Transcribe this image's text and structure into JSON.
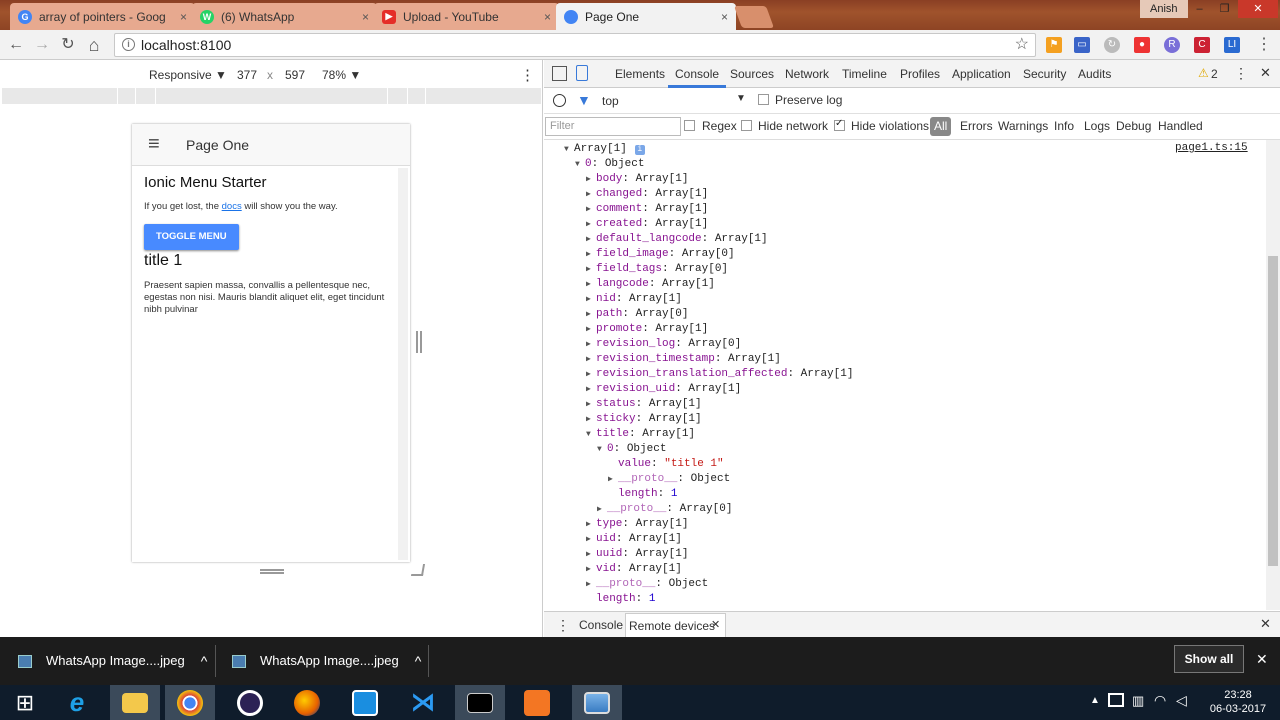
{
  "browser": {
    "tabs": [
      {
        "title": "array of pointers - Goog",
        "icon": "google-icon",
        "color": "#4285f4"
      },
      {
        "title": "(6) WhatsApp",
        "icon": "whatsapp-icon",
        "color": "#25d366"
      },
      {
        "title": "Upload - YouTube",
        "icon": "youtube-icon",
        "color": "#e52d27"
      },
      {
        "title": "Page One",
        "icon": "chrome-tab-icon",
        "color": "#4285f4"
      }
    ],
    "close_glyph": "×",
    "user": "Anish",
    "window_min": "–",
    "window_max": "❐",
    "window_close": "✕",
    "url": "localhost:8100",
    "back": "←",
    "forward": "→",
    "reload": "↻",
    "home": "⌂",
    "star": "☆",
    "menu": "⋮"
  },
  "device_toolbar": {
    "mode": "Responsive ▼",
    "width": "377",
    "x": "x",
    "height": "597",
    "zoom": "78% ▼",
    "more": "⋮"
  },
  "app": {
    "menu_icon": "≡",
    "header_title": "Page One",
    "heading": "Ionic Menu Starter",
    "intro_before": "If you get lost, the ",
    "intro_link": "docs",
    "intro_after": " will show you the way.",
    "toggle_button": "TOGGLE MENU",
    "card_title": "title 1",
    "card_text": "Praesent sapien massa, convallis a pellentesque nec, egestas non nisi. Mauris blandit aliquet elit, eget tincidunt nibh pulvinar"
  },
  "devtools": {
    "tabs": [
      "Elements",
      "Console",
      "Sources",
      "Network",
      "Timeline",
      "Profiles",
      "Application",
      "Security",
      "Audits"
    ],
    "active_tab": "Console",
    "warning_count": "2",
    "context": "top",
    "preserve_log": "Preserve log",
    "filter_placeholder": "Filter",
    "regex": "Regex",
    "hide_network": "Hide network",
    "hide_violations": "Hide violations",
    "levels": [
      "All",
      "Errors",
      "Warnings",
      "Info",
      "Logs",
      "Debug",
      "Handled"
    ],
    "source_link": "page1.ts:15",
    "drawer_tabs": [
      "Console",
      "Remote devices"
    ],
    "log_lines": [
      {
        "indent": 0,
        "arrow": "▼",
        "key": "",
        "text": "Array[1]",
        "badge": "i"
      },
      {
        "indent": 1,
        "arrow": "▼",
        "key": "0",
        "text": "Object"
      },
      {
        "indent": 2,
        "arrow": "▶",
        "key": "body",
        "text": "Array[1]"
      },
      {
        "indent": 2,
        "arrow": "▶",
        "key": "changed",
        "text": "Array[1]"
      },
      {
        "indent": 2,
        "arrow": "▶",
        "key": "comment",
        "text": "Array[1]"
      },
      {
        "indent": 2,
        "arrow": "▶",
        "key": "created",
        "text": "Array[1]"
      },
      {
        "indent": 2,
        "arrow": "▶",
        "key": "default_langcode",
        "text": "Array[1]"
      },
      {
        "indent": 2,
        "arrow": "▶",
        "key": "field_image",
        "text": "Array[0]"
      },
      {
        "indent": 2,
        "arrow": "▶",
        "key": "field_tags",
        "text": "Array[0]"
      },
      {
        "indent": 2,
        "arrow": "▶",
        "key": "langcode",
        "text": "Array[1]"
      },
      {
        "indent": 2,
        "arrow": "▶",
        "key": "nid",
        "text": "Array[1]"
      },
      {
        "indent": 2,
        "arrow": "▶",
        "key": "path",
        "text": "Array[0]"
      },
      {
        "indent": 2,
        "arrow": "▶",
        "key": "promote",
        "text": "Array[1]"
      },
      {
        "indent": 2,
        "arrow": "▶",
        "key": "revision_log",
        "text": "Array[0]"
      },
      {
        "indent": 2,
        "arrow": "▶",
        "key": "revision_timestamp",
        "text": "Array[1]"
      },
      {
        "indent": 2,
        "arrow": "▶",
        "key": "revision_translation_affected",
        "text": "Array[1]"
      },
      {
        "indent": 2,
        "arrow": "▶",
        "key": "revision_uid",
        "text": "Array[1]"
      },
      {
        "indent": 2,
        "arrow": "▶",
        "key": "status",
        "text": "Array[1]"
      },
      {
        "indent": 2,
        "arrow": "▶",
        "key": "sticky",
        "text": "Array[1]"
      },
      {
        "indent": 2,
        "arrow": "▼",
        "key": "title",
        "text": "Array[1]"
      },
      {
        "indent": 3,
        "arrow": "▼",
        "key": "0",
        "text": "Object"
      },
      {
        "indent": 4,
        "arrow": "",
        "key": "value",
        "text": "\"title 1\"",
        "kind": "string"
      },
      {
        "indent": 4,
        "arrow": "▶",
        "key": "__proto__",
        "text": "Object",
        "kind": "proto"
      },
      {
        "indent": 4,
        "arrow": "",
        "key": "length",
        "text": "1",
        "kind": "number"
      },
      {
        "indent": 3,
        "arrow": "▶",
        "key": "__proto__",
        "text": "Array[0]",
        "kind": "proto"
      },
      {
        "indent": 2,
        "arrow": "▶",
        "key": "type",
        "text": "Array[1]"
      },
      {
        "indent": 2,
        "arrow": "▶",
        "key": "uid",
        "text": "Array[1]"
      },
      {
        "indent": 2,
        "arrow": "▶",
        "key": "uuid",
        "text": "Array[1]"
      },
      {
        "indent": 2,
        "arrow": "▶",
        "key": "vid",
        "text": "Array[1]"
      },
      {
        "indent": 2,
        "arrow": "▶",
        "key": "__proto__",
        "text": "Object",
        "kind": "proto"
      },
      {
        "indent": 2,
        "arrow": "",
        "key": "length",
        "text": "1",
        "kind": "number"
      }
    ]
  },
  "downloads": {
    "items": [
      "WhatsApp Image....jpeg",
      "WhatsApp Image....jpeg"
    ],
    "chevron": "^",
    "show_all": "Show all",
    "close": "✕"
  },
  "taskbar": {
    "time": "23:28",
    "date": "06-03-2017",
    "apps": [
      "start-icon",
      "internet-explorer-icon",
      "file-explorer-icon",
      "chrome-icon",
      "eclipse-icon",
      "firefox-icon",
      "screenshot-icon",
      "vscode-icon",
      "cmd-icon",
      "xampp-icon",
      "photos-icon"
    ]
  },
  "colors": {
    "accent": "#488aff",
    "link": "#1a73e8",
    "devtools_active": "#3879d9"
  }
}
